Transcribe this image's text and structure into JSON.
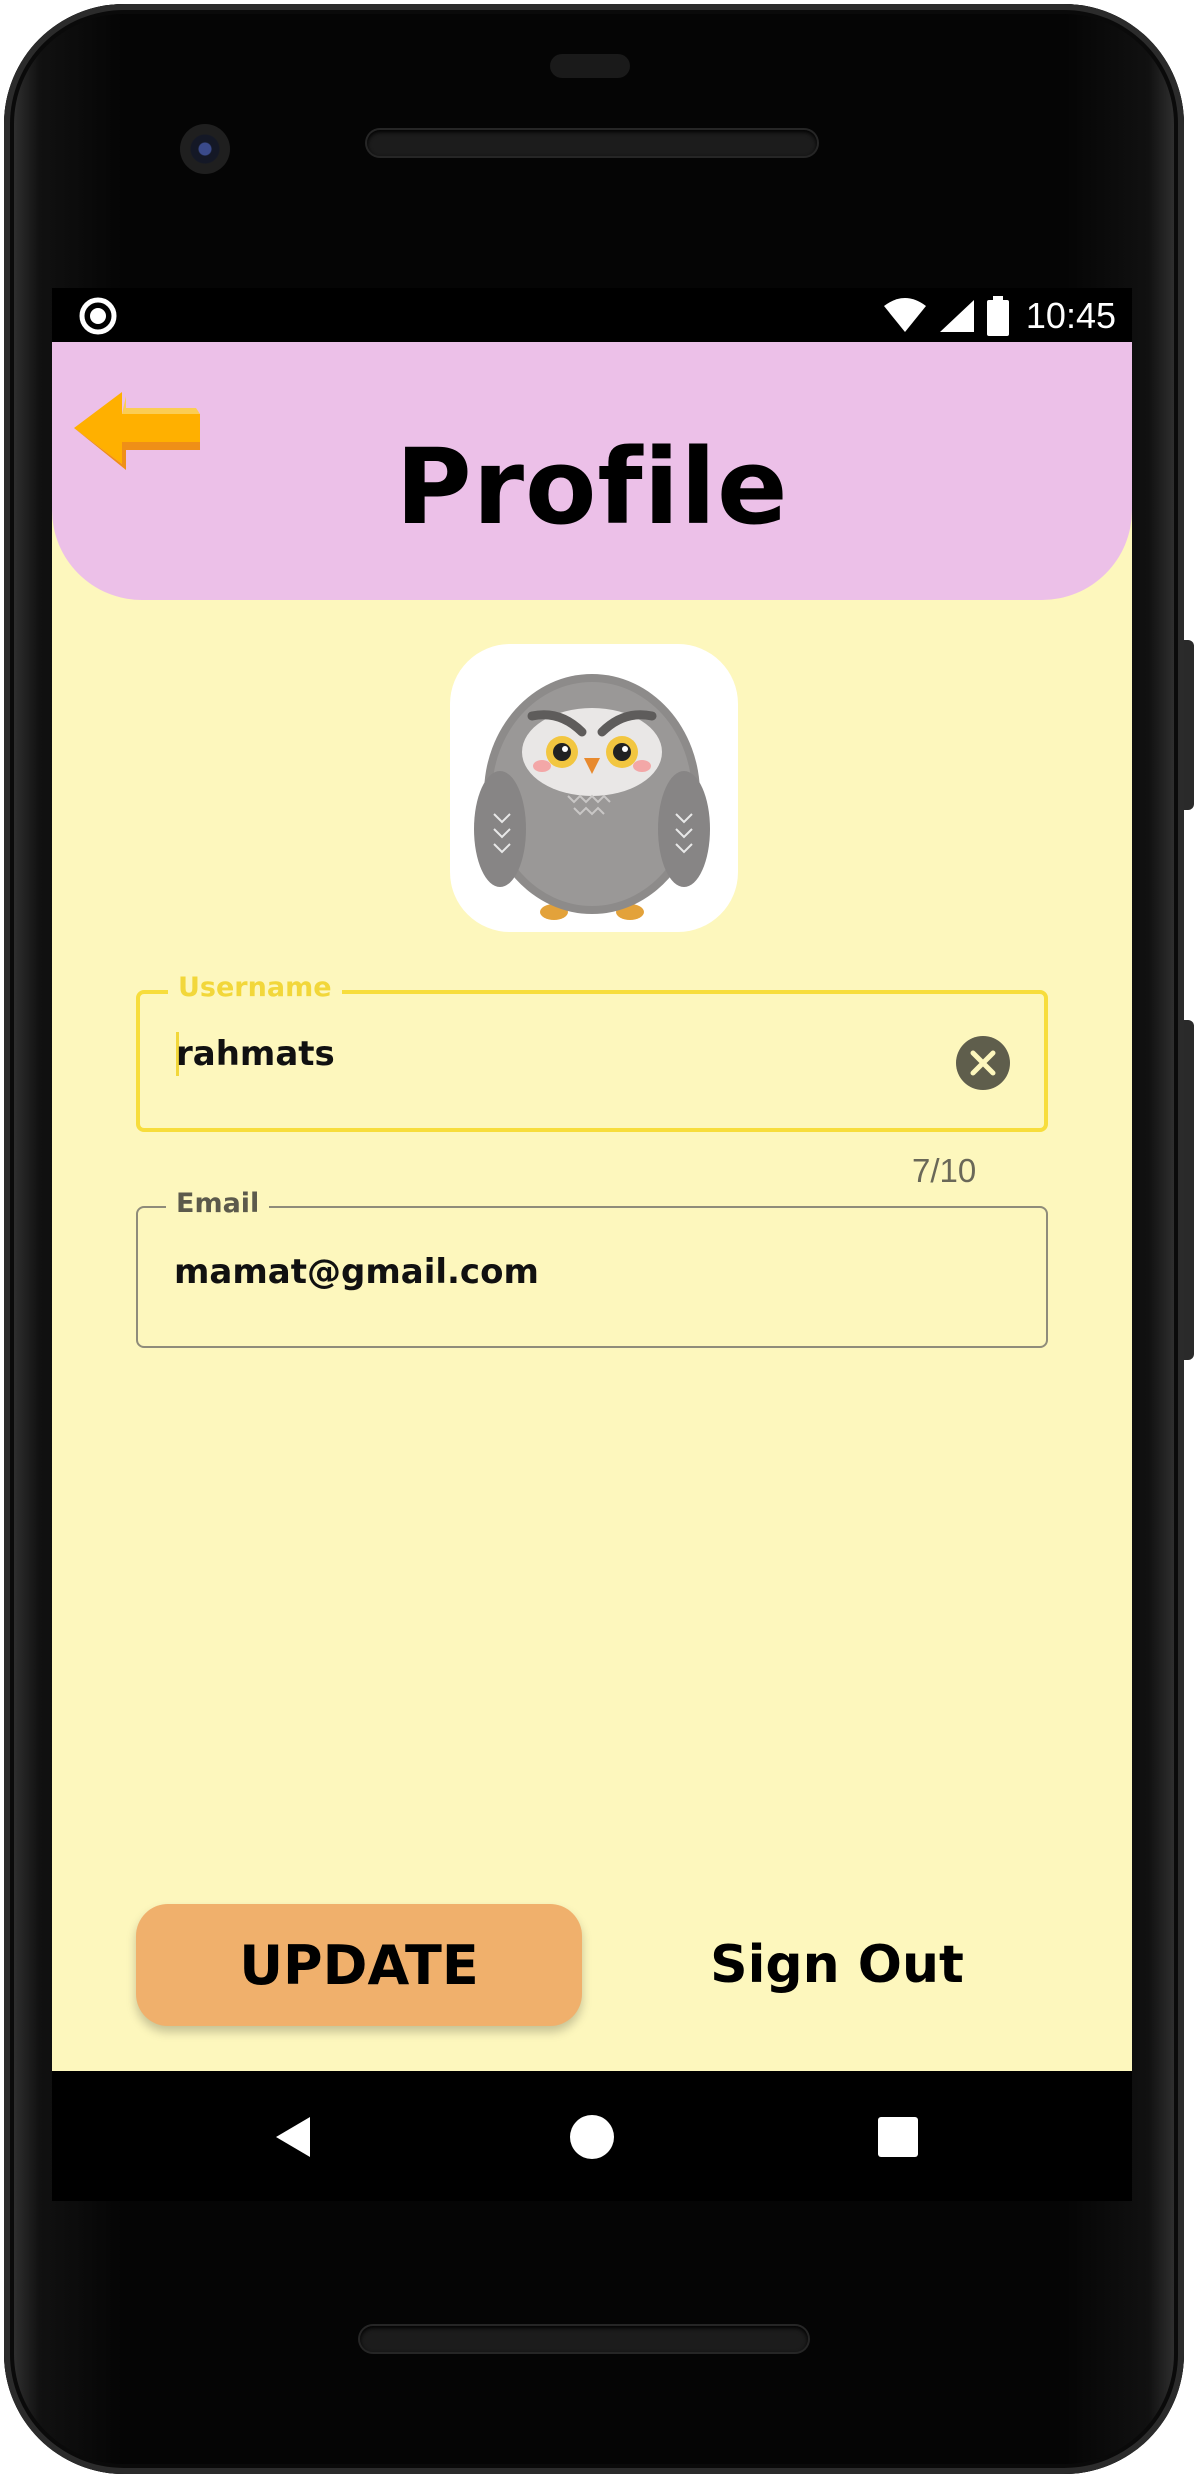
{
  "status_bar": {
    "time": "10:45"
  },
  "header": {
    "title": "Profile"
  },
  "icons": {
    "back": "back-arrow-icon",
    "avatar": "owl-avatar",
    "clear": "clear-icon",
    "record": "record-icon",
    "wifi": "wifi-icon",
    "signal": "signal-icon",
    "battery": "battery-icon"
  },
  "form": {
    "username": {
      "label": "Username",
      "value": "rahmats",
      "counter": "7/10"
    },
    "email": {
      "label": "Email",
      "value": "mamat@gmail.com"
    }
  },
  "actions": {
    "update_label": "UPDATE",
    "signout_label": "Sign Out"
  },
  "colors": {
    "background": "#fdf7bd",
    "header": "#ecc0e8",
    "accent": "#f7dd3c",
    "update_button": "#f0b06c",
    "back_arrow": "#ffaa00"
  }
}
